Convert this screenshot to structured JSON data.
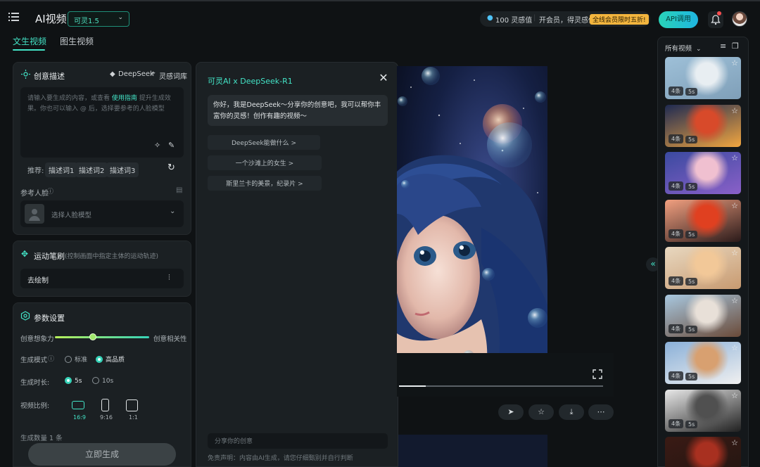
{
  "topbar": {
    "app_title": "AI视频",
    "model": "可灵1.5",
    "credits_value": "100 灵感值",
    "membership_text": "开会员，得灵感值",
    "promo_badge": "全线会员限时五折!",
    "api_button": "API调用"
  },
  "tabs": [
    {
      "label": "文生视频",
      "active": true
    },
    {
      "label": "图生视频",
      "active": false
    }
  ],
  "creative": {
    "title": "创意描述",
    "deepseek_link": "DeepSeek",
    "library_link": "灵感词库",
    "prompt_placeholder_1": "请输入要生成的内容，或查看",
    "prompt_guide_link": "使用指南",
    "prompt_placeholder_2": "提升生成效果。你也可以输入 @ 后，选择要参考的人脸模型",
    "recommend_label": "推荐:",
    "recommend_chips": [
      "描述词1",
      "描述词2",
      "描述词3"
    ]
  },
  "reference_face": {
    "label": "参考人脸",
    "select_placeholder": "选择人脸模型"
  },
  "motion_brush": {
    "title": "运动笔刷",
    "subtitle": "(控制画面中指定主体的运动轨迹)",
    "draw_button": "去绘制"
  },
  "params": {
    "title": "参数设置",
    "slider_left": "创意想象力",
    "slider_right": "创意相关性",
    "slider_value": 0.4,
    "mode_label": "生成模式",
    "mode_options": [
      "标准",
      "高品质"
    ],
    "mode_selected": "高品质",
    "duration_label": "生成时长:",
    "duration_options": [
      "5s",
      "10s"
    ],
    "duration_selected": "5s",
    "ratio_label": "视频比例:",
    "ratio_options": [
      "16:9",
      "9:16",
      "1:1"
    ],
    "ratio_selected": "16:9",
    "count_label": "生成数量",
    "count_value": "1 条",
    "generate_button": "立即生成"
  },
  "chat": {
    "title": "可灵AI x DeepSeek-R1",
    "greeting": "你好，我是DeepSeek～分享你的创意吧，我可以帮你丰富你的灵感！创作有趣的视频～",
    "suggestions": [
      "DeepSeek能做什么 >",
      "一个沙滩上的女生 >",
      "斯里兰卡的美景，纪录片 >"
    ],
    "input_placeholder": "分享你的创意",
    "disclaimer": "免责声明：内容由AI生成，请您仔细甄别并自行判断"
  },
  "player": {
    "progress": 0.13
  },
  "history": {
    "filter_label": "所有视频",
    "items": [
      {
        "count": "4条",
        "duration": "5s",
        "colors": [
          "#9ec0d8",
          "#e8eef2",
          "#7f9fb8"
        ]
      },
      {
        "count": "4条",
        "duration": "5s",
        "colors": [
          "#1e2a52",
          "#d84a2a",
          "#f2a640"
        ]
      },
      {
        "count": "4条",
        "duration": "5s",
        "colors": [
          "#3a4aa0",
          "#f0c0d0",
          "#8a60c8"
        ]
      },
      {
        "count": "4条",
        "duration": "5s",
        "colors": [
          "#f2a080",
          "#e04020",
          "#2a1a1a"
        ]
      },
      {
        "count": "4条",
        "duration": "5s",
        "colors": [
          "#e8d8c0",
          "#f2c898",
          "#c89a70"
        ]
      },
      {
        "count": "4条",
        "duration": "5s",
        "colors": [
          "#a8c8e0",
          "#e8e0d8",
          "#6a4a38"
        ]
      },
      {
        "count": "4条",
        "duration": "5s",
        "colors": [
          "#8ab0d8",
          "#d8a070",
          "#f0f0f0"
        ]
      },
      {
        "count": "4条",
        "duration": "5s",
        "colors": [
          "#e8e8e8",
          "#505050",
          "#202020"
        ]
      },
      {
        "count": "",
        "duration": "",
        "colors": [
          "#3a1a14",
          "#a83020",
          "#221612"
        ]
      }
    ]
  }
}
